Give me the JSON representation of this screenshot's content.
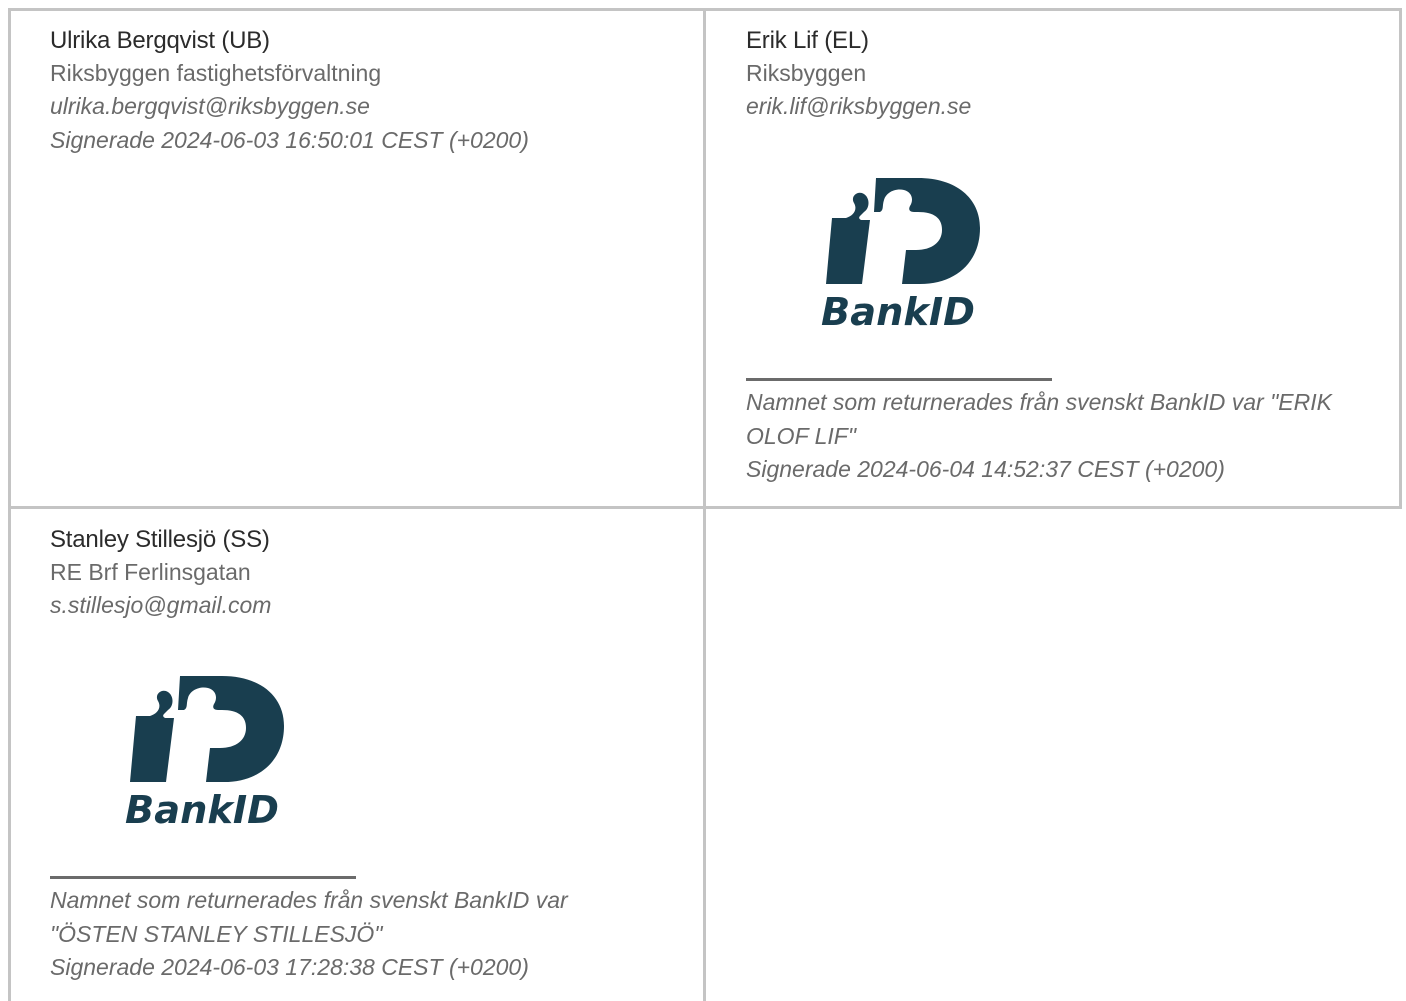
{
  "signers": [
    {
      "name": "Ulrika Bergqvist (UB)",
      "organization": "Riksbyggen fastighetsförvaltning",
      "email": "ulrika.bergqvist@riksbyggen.se",
      "signed": "Signerade 2024-06-03 16:50:01 CEST (+0200)"
    },
    {
      "name": "Erik Lif (EL)",
      "organization": "Riksbyggen",
      "email": "erik.lif@riksbyggen.se",
      "bankid_logo_text": "BankID",
      "bankid_name": "Namnet som returnerades från svenskt BankID var \"ERIK OLOF LIF\"",
      "signed": "Signerade 2024-06-04 14:52:37 CEST (+0200)"
    },
    {
      "name": "Stanley Stillesjö (SS)",
      "organization": "RE Brf Ferlinsgatan",
      "email": "s.stillesjo@gmail.com",
      "bankid_logo_text": "BankID",
      "bankid_name": "Namnet som returnerades från svenskt BankID var \"ÖSTEN STANLEY STILLESJÖ\"",
      "signed": "Signerade 2024-06-03 17:28:38 CEST (+0200)"
    }
  ],
  "colors": {
    "bankid_blue": "#193e4f",
    "border": "#c4c4c4",
    "text_muted": "#6a6a6a"
  }
}
